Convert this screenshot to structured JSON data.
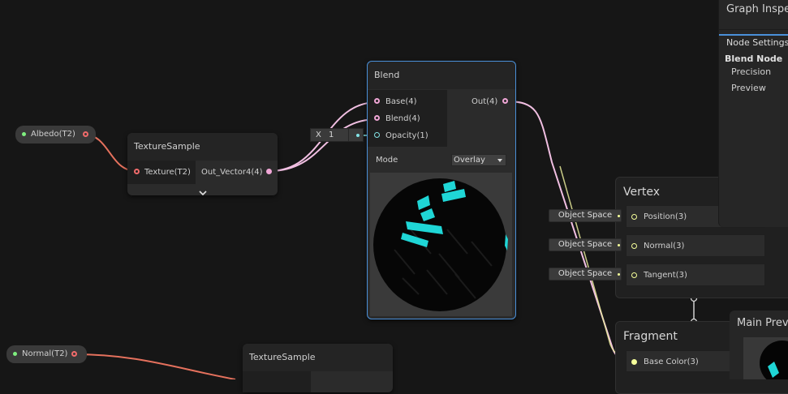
{
  "albedo_property": {
    "label": "Albedo(T2)"
  },
  "normal_property": {
    "label": "Normal(T2)"
  },
  "texture_sample_1": {
    "title": "TextureSample",
    "input_label": "Texture(T2)",
    "output_label": "Out_Vector4(4)",
    "expand_icon": "chevron-down-icon"
  },
  "texture_sample_2": {
    "title": "TextureSample"
  },
  "opacity_input": {
    "axis": "X",
    "value": "1"
  },
  "blend_node": {
    "title": "Blend",
    "inputs": [
      "Base(4)",
      "Blend(4)",
      "Opacity(1)"
    ],
    "output_label": "Out(4)",
    "mode_label": "Mode",
    "mode_value": "Overlay"
  },
  "vertex_block": {
    "title": "Vertex",
    "slots": [
      {
        "space": "Object Space",
        "label": "Position(3)"
      },
      {
        "space": "Object Space",
        "label": "Normal(3)"
      },
      {
        "space": "Object Space",
        "label": "Tangent(3)"
      }
    ]
  },
  "fragment_block": {
    "title": "Fragment",
    "slots": [
      {
        "label": "Base Color(3)"
      }
    ]
  },
  "graph_inspector": {
    "title": "Graph Inspe",
    "tab": "Node Settings",
    "section": "Blend Node",
    "items": [
      "Precision",
      "Preview"
    ]
  },
  "main_preview": {
    "title": "Main Previ"
  },
  "colors": {
    "texture_port": "#f06b6b",
    "vector4_port": "#f0a6d6",
    "float_port": "#84e4e7",
    "vector3_port": "#f6ff9a",
    "vector3_wire": "#e8ea9a",
    "selection": "#4a90d9",
    "cyan": "#1fd6d6"
  }
}
